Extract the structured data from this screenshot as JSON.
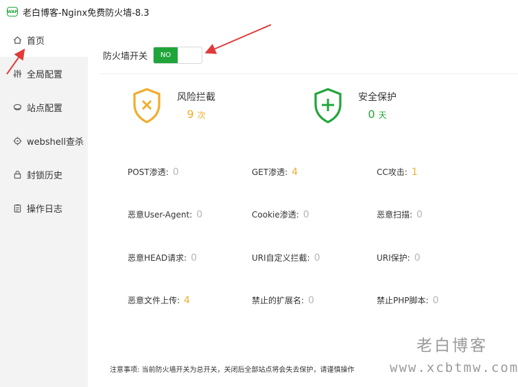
{
  "window": {
    "title": "老白博客-Nginx免费防火墙-8.3",
    "icon_label": "WAF"
  },
  "sidebar": {
    "items": [
      {
        "label": "首页",
        "icon": "home-icon"
      },
      {
        "label": "全局配置",
        "icon": "sliders-icon"
      },
      {
        "label": "站点配置",
        "icon": "site-icon"
      },
      {
        "label": "webshell查杀",
        "icon": "crosshair-icon"
      },
      {
        "label": "封锁历史",
        "icon": "lock-icon"
      },
      {
        "label": "操作日志",
        "icon": "clipboard-icon"
      }
    ]
  },
  "firewall": {
    "label": "防火墙开关",
    "toggle_text": "NO"
  },
  "stats": {
    "risk": {
      "title": "风险拦截",
      "value": "9",
      "unit": "次",
      "color": "#f0ad2b"
    },
    "safe": {
      "title": "安全保护",
      "value": "0",
      "unit": "天",
      "color": "#20a53a"
    }
  },
  "metrics": [
    {
      "label": "POST渗透:",
      "value": "0"
    },
    {
      "label": "GET渗透:",
      "value": "4"
    },
    {
      "label": "CC攻击:",
      "value": "1"
    },
    {
      "label": "恶意User-Agent:",
      "value": "0"
    },
    {
      "label": "Cookie渗透:",
      "value": "0"
    },
    {
      "label": "恶意扫描:",
      "value": "0"
    },
    {
      "label": "恶意HEAD请求:",
      "value": "0"
    },
    {
      "label": "URI自定义拦截:",
      "value": "0"
    },
    {
      "label": "URI保护:",
      "value": "0"
    },
    {
      "label": "恶意文件上传:",
      "value": "4"
    },
    {
      "label": "禁止的扩展名:",
      "value": "0"
    },
    {
      "label": "禁止PHP脚本:",
      "value": "0"
    }
  ],
  "footer": {
    "note": "注意事项: 当前防火墙开关为总开关，关闭后全部站点将会失去保护，请谨慎操作"
  },
  "watermark": {
    "text": "老白博客",
    "url": "www.xcbtmw.com"
  },
  "colors": {
    "accent": "#20a53a",
    "warn": "#f0ad2b",
    "muted": "#b5b5b5",
    "annotation": "#e03a3a"
  }
}
